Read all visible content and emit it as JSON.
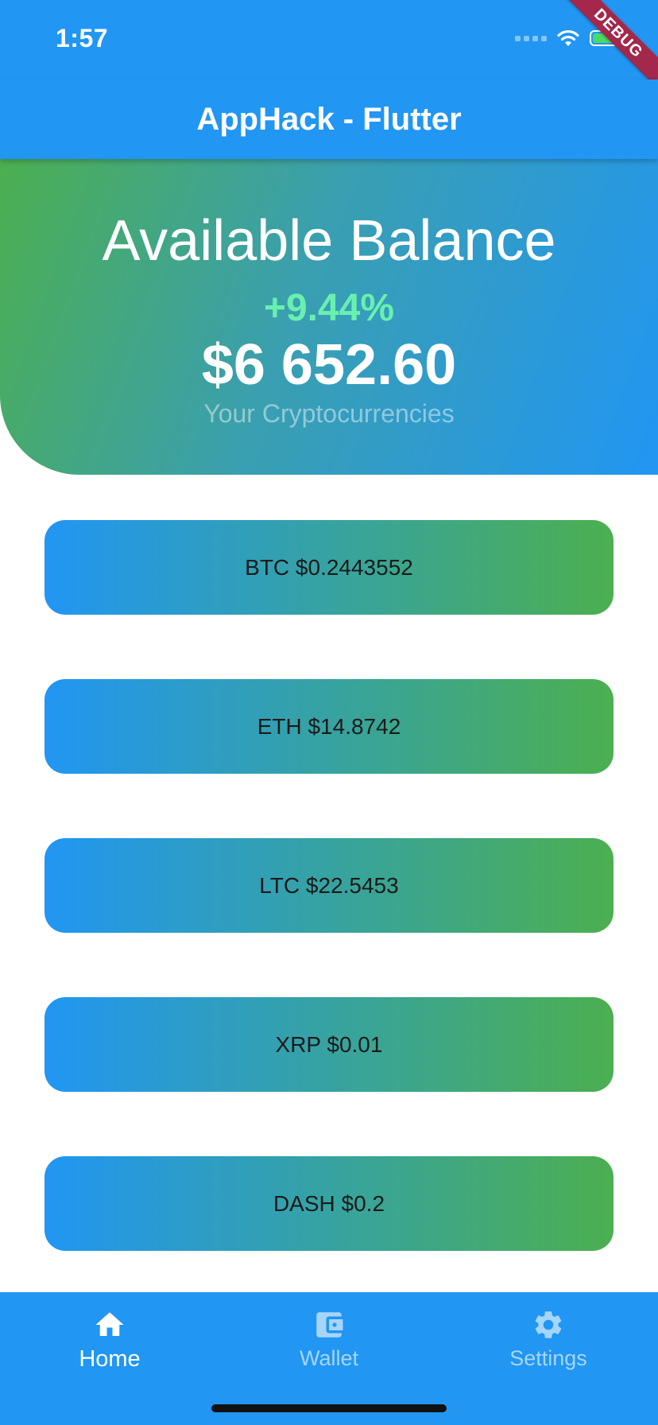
{
  "status_bar": {
    "time": "1:57"
  },
  "debug_banner": "DEBUG",
  "app_bar": {
    "title": "AppHack - Flutter"
  },
  "balance": {
    "title": "Available Balance",
    "change": "+9.44%",
    "amount": "$6 652.60",
    "caption": "Your Cryptocurrencies"
  },
  "coins": [
    {
      "label": "BTC $0.2443552"
    },
    {
      "label": "ETH $14.8742"
    },
    {
      "label": "LTC $22.5453"
    },
    {
      "label": "XRP $0.01"
    },
    {
      "label": "DASH $0.2"
    }
  ],
  "bottom_nav": {
    "active_index": 0,
    "items": [
      {
        "label": "Home",
        "icon": "home-icon"
      },
      {
        "label": "Wallet",
        "icon": "wallet-icon"
      },
      {
        "label": "Settings",
        "icon": "settings-icon"
      }
    ]
  },
  "colors": {
    "primary": "#2196F3",
    "accent_green": "#4CAF50",
    "change_positive": "#69F0AE",
    "debug_ribbon": "#A3284B"
  }
}
